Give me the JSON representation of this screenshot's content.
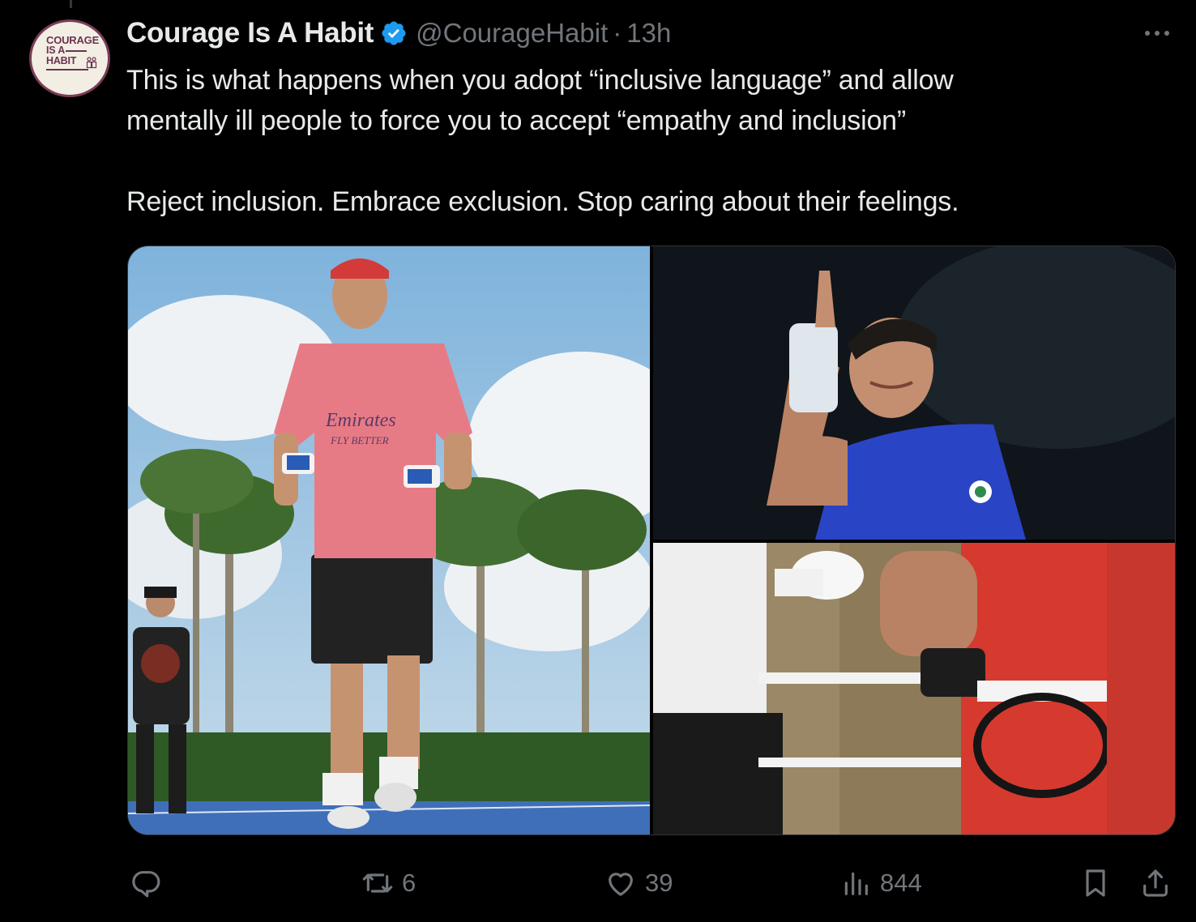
{
  "author": {
    "display_name": "Courage Is A Habit",
    "handle": "@CourageHabit",
    "separator": "·",
    "time": "13h",
    "verified": true,
    "avatar": {
      "line1": "COURAGE",
      "line2": "IS A",
      "line3": "HABIT",
      "brand_color": "#6b3350"
    }
  },
  "tweet": {
    "paragraph1_line1": "This is what happens when you adopt “inclusive language” and allow",
    "paragraph1_line2": "mentally ill people to force you to accept “empathy and inclusion”",
    "paragraph2": "Reject inclusion. Embrace exclusion. Stop caring about their feelings."
  },
  "media": {
    "count": 3,
    "photos": [
      {
        "name": "runner-on-track",
        "jersey_text_1": "Emirates",
        "jersey_text_2": "FLY BETTER"
      },
      {
        "name": "boxer-pointing-up"
      },
      {
        "name": "boxer-at-ring-ropes"
      }
    ]
  },
  "actions": {
    "reply": {
      "icon": "reply-icon",
      "count": ""
    },
    "retweet": {
      "icon": "retweet-icon",
      "count": "6"
    },
    "like": {
      "icon": "heart-icon",
      "count": "39"
    },
    "views": {
      "icon": "views-icon",
      "count": "844"
    },
    "bookmark": {
      "icon": "bookmark-icon"
    },
    "share": {
      "icon": "share-icon"
    }
  },
  "colors": {
    "background": "#000000",
    "text_primary": "#e7e9ea",
    "text_secondary": "#71767b",
    "verified_blue": "#1d9bf0",
    "border": "#2f3336"
  }
}
